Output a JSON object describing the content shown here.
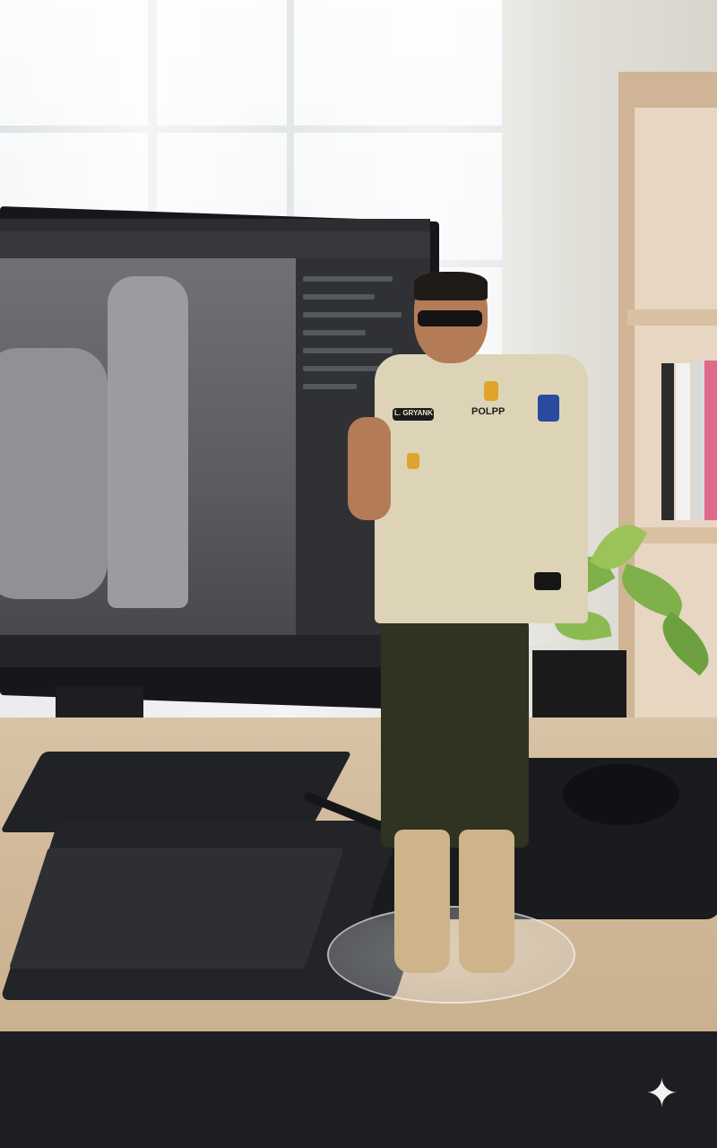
{
  "scene": {
    "figure": {
      "name_tag": "L. GRYANK",
      "chest_label": "POLPP"
    },
    "watermark_icon": "sparkle-icon",
    "colors": {
      "shirt": "#ddd4b8",
      "pants": "#2f3322",
      "boots": "#cdb48a",
      "desk": "#cfb797",
      "screen": "#4a4c4f"
    }
  }
}
